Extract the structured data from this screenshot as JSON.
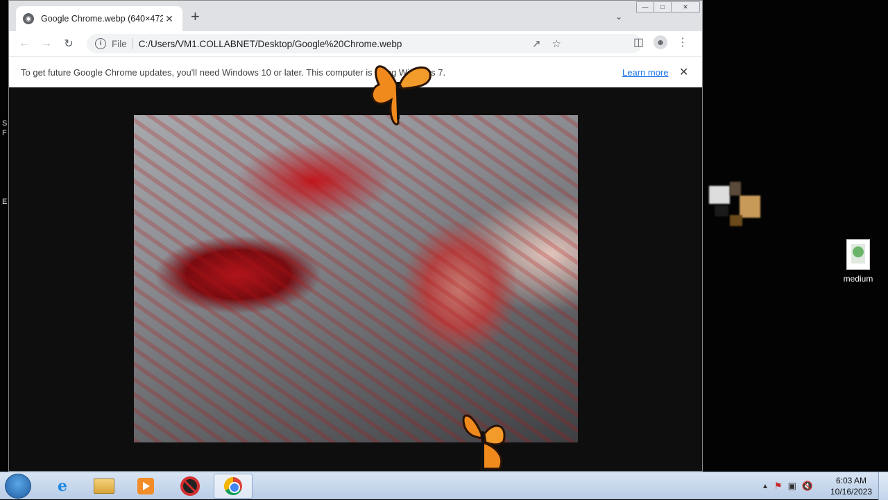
{
  "desktop": {
    "icon_label": "medium",
    "edge_fragments": [
      "S",
      "F",
      "E"
    ]
  },
  "browser": {
    "tab_title": "Google Chrome.webp (640×472)",
    "new_tab_symbol": "+",
    "address_scheme": "File",
    "address_url": "C:/Users/VM1.COLLABNET/Desktop/Google%20Chrome.webp",
    "infobar_text": "To get future Google Chrome updates, you'll need Windows 10 or later. This computer is using Windows 7.",
    "infobar_link": "Learn more",
    "image_dimensions": "640×472"
  },
  "taskbar": {
    "time": "6:03 AM",
    "date": "10/16/2023",
    "pinned": [
      "internet-explorer-icon",
      "file-explorer-icon",
      "media-player-icon",
      "blocked-app-icon",
      "chrome-icon"
    ]
  }
}
